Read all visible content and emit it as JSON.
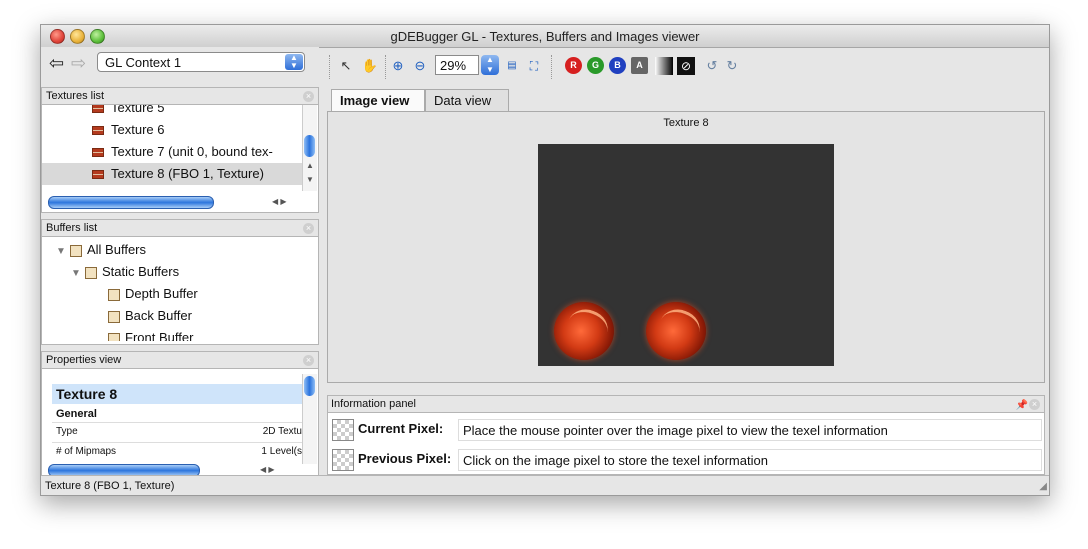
{
  "window": {
    "title": "gDEBugger GL - Textures, Buffers and Images viewer"
  },
  "nav": {
    "context": "GL Context 1"
  },
  "textures": {
    "header": "Textures list",
    "items": [
      {
        "label": "Texture 5",
        "selected": false
      },
      {
        "label": "Texture 6",
        "selected": false
      },
      {
        "label": "Texture 7 (unit 0, bound tex-",
        "selected": false
      },
      {
        "label": "Texture 8 (FBO 1, Texture)",
        "selected": true
      }
    ]
  },
  "buffers": {
    "header": "Buffers list",
    "items": [
      {
        "label": "All Buffers",
        "level": 0,
        "expanded": true
      },
      {
        "label": "Static Buffers",
        "level": 1,
        "expanded": true
      },
      {
        "label": "Depth Buffer",
        "level": 2
      },
      {
        "label": "Back Buffer",
        "level": 2
      },
      {
        "label": "Front Buffer",
        "level": 2
      }
    ]
  },
  "properties": {
    "header": "Properties view",
    "title": "Texture 8",
    "section": "General",
    "rows": [
      {
        "key": "Type",
        "value": "2D Textu"
      },
      {
        "key": "# of Mipmaps",
        "value": "1 Level(s"
      }
    ]
  },
  "toolbar": {
    "zoom": "29%",
    "channels": [
      {
        "label": "R",
        "color": "#d62020"
      },
      {
        "label": "G",
        "color": "#2a9a2a"
      },
      {
        "label": "B",
        "color": "#2040c0"
      },
      {
        "label": "A",
        "color": "#666666"
      }
    ]
  },
  "tabs": [
    {
      "label": "Image view",
      "active": true
    },
    {
      "label": "Data view",
      "active": false
    }
  ],
  "image_view": {
    "title": "Texture 8"
  },
  "info_panel": {
    "header": "Information panel",
    "current_label": "Current Pixel:",
    "current_value": "Place the mouse pointer over the image pixel to view the texel information",
    "previous_label": "Previous Pixel:",
    "previous_value": "Click on the image pixel to store the texel information"
  },
  "status": {
    "text": "Texture 8 (FBO 1, Texture)"
  }
}
